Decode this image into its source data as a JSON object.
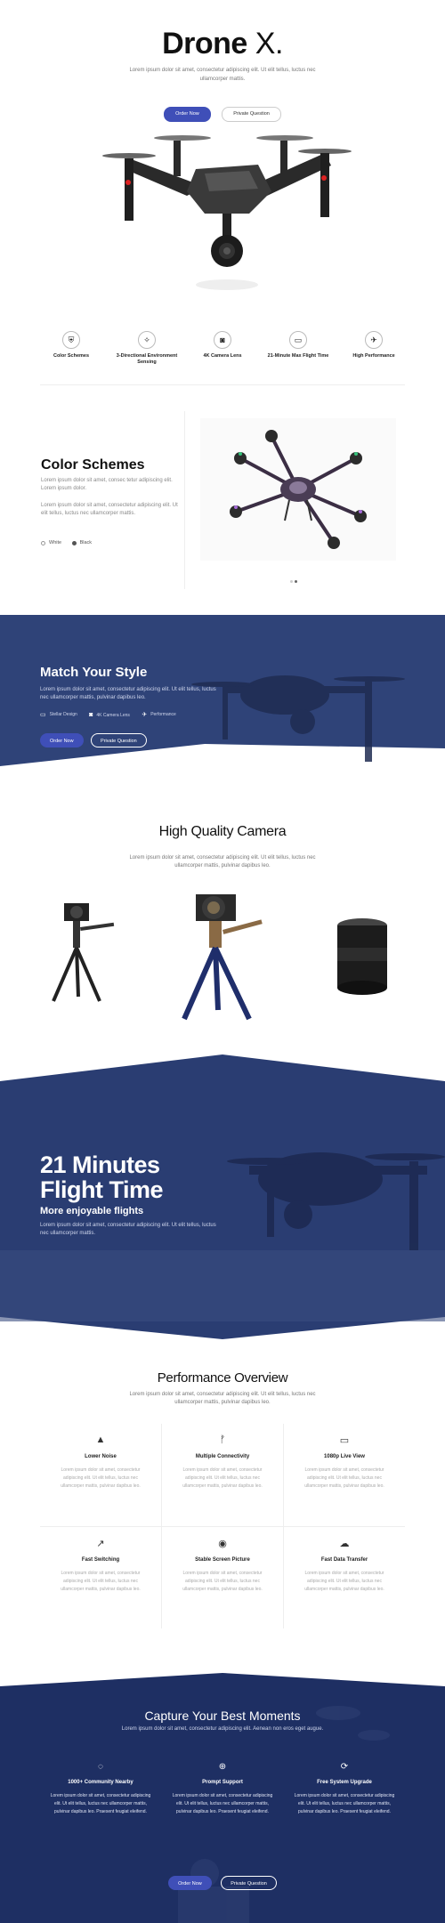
{
  "hero": {
    "title_bold": "Drone",
    "title_light": "X.",
    "subtitle": "Lorem ipsum dolor sit amet, consectetur adipiscing elit. Ut elit tellus, luctus nec ullamcorper mattis.",
    "order_btn": "Order Now",
    "question_btn": "Private Question"
  },
  "features": [
    {
      "icon": "shield-icon",
      "label": "Color Schemes"
    },
    {
      "icon": "compass-icon",
      "label": "3-Directional Environment Sensing"
    },
    {
      "icon": "camera-icon",
      "label": "4K Camera Lens"
    },
    {
      "icon": "battery-icon",
      "label": "21-Minute Max Flight Time"
    },
    {
      "icon": "plane-icon",
      "label": "High Performance"
    }
  ],
  "colors": {
    "title": "Color Schemes",
    "p1": "Lorem ipsum dolor sit amet, consec tetur adipiscing elit. Lorem ipsum dolor.",
    "p2": "Lorem ipsum dolor sit amet, consectetur adipiscing elit. Ut elit tellus, luctus nec ullamcorper mattis.",
    "swatch1": "White",
    "swatch2": "Black"
  },
  "match": {
    "title": "Match Your Style",
    "text": "Lorem ipsum dolor sit amet, consectetur adipiscing elit. Ut elit tellus, luctus nec ullamcorper mattis, pulvinar dapibus leo.",
    "tag1": "Stellar Design",
    "tag2": "4K Camera Lens",
    "tag3": "Performance",
    "order_btn": "Order Now",
    "question_btn": "Private Question"
  },
  "camera": {
    "title": "High Quality Camera",
    "subtitle": "Lorem ipsum dolor sit amet, consectetur adipiscing elit. Ut elit tellus, luctus nec ullamcorper mattis, pulvinar dapibus leo."
  },
  "flight": {
    "title": "21 Minutes Flight Time",
    "subtitle": "More enjoyable flights",
    "text": "Lorem ipsum dolor sit amet, consectetur adipiscing elit. Ut elit tellus, luctus nec ullamcorper mattis."
  },
  "performance": {
    "title": "Performance Overview",
    "subtitle": "Lorem ipsum dolor sit amet, consectetur adipiscing elit. Ut elit tellus, luctus nec ullamcorper mattis, pulvinar dapibus leo.",
    "items": [
      {
        "icon": "chart-area-icon",
        "title": "Lower Noise",
        "text": "Lorem ipsum dolor sit amet, consectetur adipiscing elit. Ut elit tellus, luctus nec ullamcorper mattis, pulvinar dapibus leo."
      },
      {
        "icon": "antenna-icon",
        "title": "Multiple Connectivity",
        "text": "Lorem ipsum dolor sit amet, consectetur adipiscing elit. Ut elit tellus, luctus nec ullamcorper mattis, pulvinar dapibus leo."
      },
      {
        "icon": "monitor-icon",
        "title": "1080p Live View",
        "text": "Lorem ipsum dolor sit amet, consectetur adipiscing elit. Ut elit tellus, luctus nec ullamcorper mattis, pulvinar dapibus leo."
      },
      {
        "icon": "chart-line-icon",
        "title": "Fast Switching",
        "text": "Lorem ipsum dolor sit amet, consectetur adipiscing elit. Ut elit tellus, luctus nec ullamcorper mattis, pulvinar dapibus leo."
      },
      {
        "icon": "eye-icon",
        "title": "Stable Screen Picture",
        "text": "Lorem ipsum dolor sit amet, consectetur adipiscing elit. Ut elit tellus, luctus nec ullamcorper mattis, pulvinar dapibus leo."
      },
      {
        "icon": "cloud-upload-icon",
        "title": "Fast Data Transfer",
        "text": "Lorem ipsum dolor sit amet, consectetur adipiscing elit. Ut elit tellus, luctus nec ullamcorper mattis, pulvinar dapibus leo."
      }
    ]
  },
  "capture": {
    "title": "Capture Your Best Moments",
    "subtitle": "Lorem ipsum dolor sit amet, consectetur adipiscing elit. Aenean non eros eget augue.",
    "cols": [
      {
        "icon": "chat-icon",
        "title": "1000+ Community Nearby",
        "text": "Lorem ipsum dolor sit amet, consectetur adipiscing elit. Ut elit tellus, luctus nec ullamcorper mattis, pulvinar dapibus leo. Praesent feugiat eleifend."
      },
      {
        "icon": "lifebuoy-icon",
        "title": "Prompt Support",
        "text": "Lorem ipsum dolor sit amet, consectetur adipiscing elit. Ut elit tellus, luctus nec ullamcorper mattis, pulvinar dapibus leo. Praesent feugiat eleifend."
      },
      {
        "icon": "sync-icon",
        "title": "Free System Upgrade",
        "text": "Lorem ipsum dolor sit amet, consectetur adipiscing elit. Ut elit tellus, luctus nec ullamcorper mattis, pulvinar dapibus leo. Praesent feugiat eleifend."
      }
    ],
    "order_btn": "Order Now",
    "question_btn": "Private Question"
  },
  "colors_theme": {
    "accent": "#3f4fb8",
    "navy": "#1e2f63",
    "navy_light": "#2d3f75"
  }
}
